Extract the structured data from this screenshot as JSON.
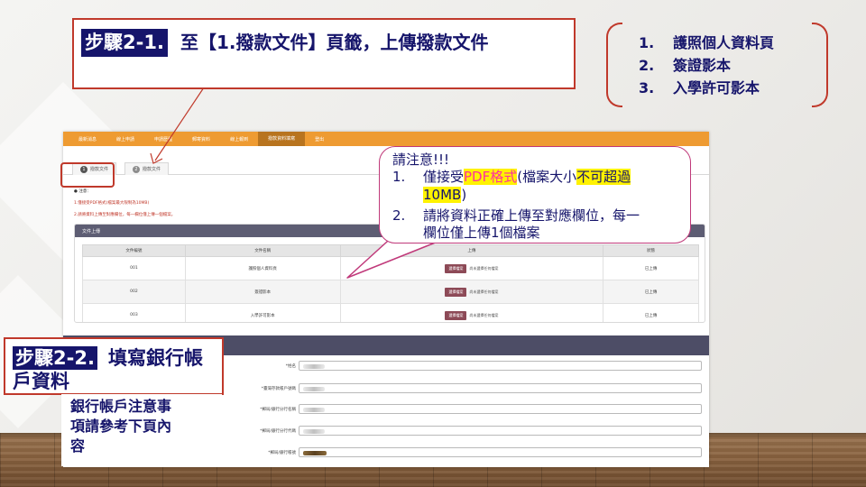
{
  "step1": {
    "label": "步驟2-1.",
    "text": "至【1.撥款文件】頁籤，上傳撥款文件"
  },
  "requirements": [
    {
      "num": "1.",
      "text": "護照個人資料頁"
    },
    {
      "num": "2.",
      "text": "簽證影本"
    },
    {
      "num": "3.",
      "text": "入學許可影本"
    }
  ],
  "notice": {
    "title": "請注意!!!",
    "item1_num": "1.",
    "item1_a": "僅接受",
    "item1_pdf": "PDF格式",
    "item1_b": "(檔案大小",
    "item1_limit": "不可超過",
    "item1_size": "10MB",
    "item1_c": ")",
    "item2_num": "2.",
    "item2_line1": "請將資料正確上傳至對應欄位，每一",
    "item2_line2": "欄位僅上傳1個檔案"
  },
  "step2": {
    "label": "步驟2-2.",
    "text1": "填寫銀行帳",
    "text2": "戶資料"
  },
  "bank_note": {
    "line1": "銀行帳戶注意事",
    "line2": "項請參考下頁內",
    "line3": "容"
  },
  "screenshot": {
    "nav": [
      "最新消息",
      "線上申請",
      "申請歷程",
      "郵寄資料",
      "線上報到",
      "撥款資料填寫",
      "登出"
    ],
    "tabs": [
      {
        "num": "1",
        "label": "撥款文件"
      },
      {
        "num": "2",
        "label": "撥款文件"
      }
    ],
    "notes_title": "● 注意：",
    "notes": [
      "1.僅接受PDF格式(檔案最大限制為10MB)",
      "2.請將資料上傳至對應欄位，每一欄位僅上傳一個檔案。"
    ],
    "panel_title": "文件上傳",
    "table_headers": [
      "文件編號",
      "文件名稱",
      "上傳",
      "狀態"
    ],
    "rows": [
      {
        "no": "001",
        "name": "護照個人資料頁",
        "btn": "選擇檔案",
        "note": "尚未選擇任何檔案",
        "status": "已上傳"
      },
      {
        "no": "002",
        "name": "簽證影本",
        "btn": "選擇檔案",
        "note": "尚未選擇任何檔案",
        "status": "已上傳"
      },
      {
        "no": "003",
        "name": "入學許可影本",
        "btn": "選擇檔案",
        "note": "尚未選擇任何檔案",
        "status": "已上傳"
      }
    ],
    "bank_fields": [
      "*姓名",
      "*臺灣存款帳戶號碼",
      "*郵局/銀行分行名稱",
      "*郵局/銀行分行代碼",
      "*郵局/銀行帳號"
    ]
  },
  "colors": {
    "accent": "#c0392b",
    "navy": "#16156b",
    "nav_bar": "#ee9b32",
    "panel_head": "#5d5d73",
    "highlight": "#fff200",
    "pdf_pink": "#ff2fa0"
  }
}
